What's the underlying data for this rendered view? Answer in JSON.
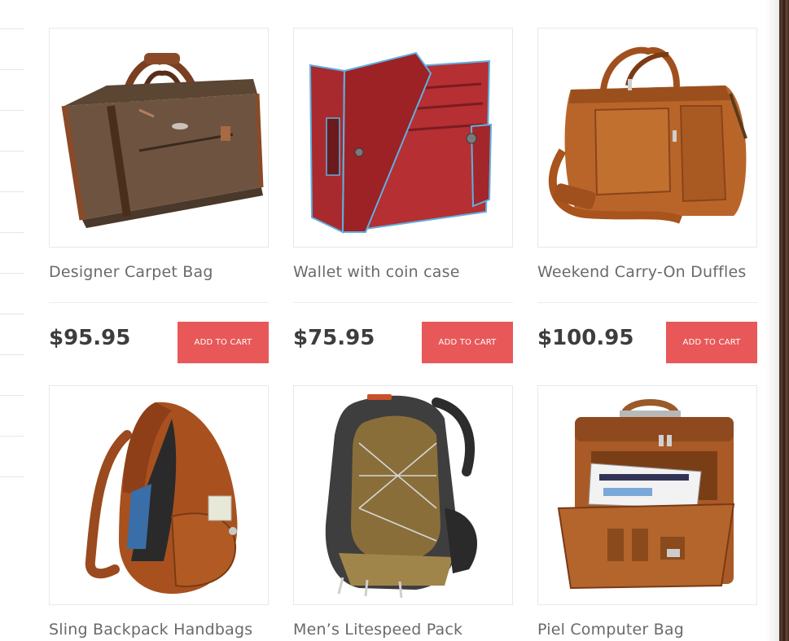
{
  "products": [
    {
      "title": "Designer Carpet Bag",
      "price": "$95.95",
      "cart_label": "ADD TO CART",
      "image": "brown-carpet-bag-image"
    },
    {
      "title": "Wallet with coin case",
      "price": "$75.95",
      "cart_label": "ADD TO CART",
      "image": "red-wallet-image"
    },
    {
      "title": "Weekend Carry-On Duffles",
      "price": "$100.95",
      "cart_label": "ADD TO CART",
      "image": "leather-duffle-image"
    },
    {
      "title": "Sling Backpack Handbags",
      "image": "sling-backpack-image"
    },
    {
      "title": "Men’s Litespeed Pack",
      "image": "hiking-backpack-image"
    },
    {
      "title": "Piel Computer Bag",
      "image": "computer-bag-image"
    }
  ],
  "colors": {
    "cart_button": "#e85858",
    "title_text": "#6a6a6a",
    "price_text": "#3d3d3d"
  }
}
